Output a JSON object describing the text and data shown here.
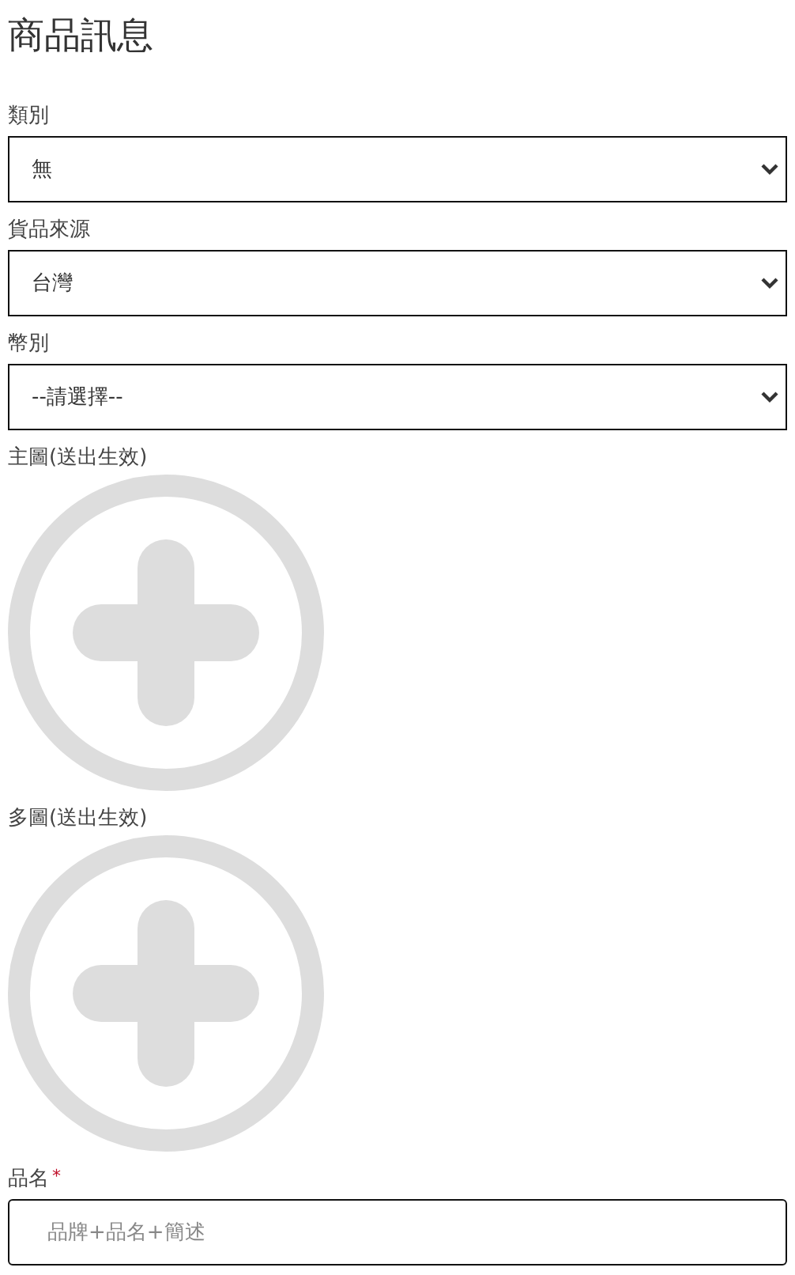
{
  "title": "商品訊息",
  "fields": [
    {
      "kind": "select",
      "label": "類別",
      "value": "無"
    },
    {
      "kind": "select",
      "label": "貨品來源",
      "value": "台灣"
    },
    {
      "kind": "select",
      "label": "幣別",
      "value": "--請選擇--"
    },
    {
      "kind": "image",
      "label": "主圖(送出生效)"
    },
    {
      "kind": "image",
      "label": "多圖(送出生效)"
    },
    {
      "kind": "text",
      "label": "品名",
      "required_mark": "*",
      "placeholder": "品牌+品名+簡述"
    }
  ]
}
